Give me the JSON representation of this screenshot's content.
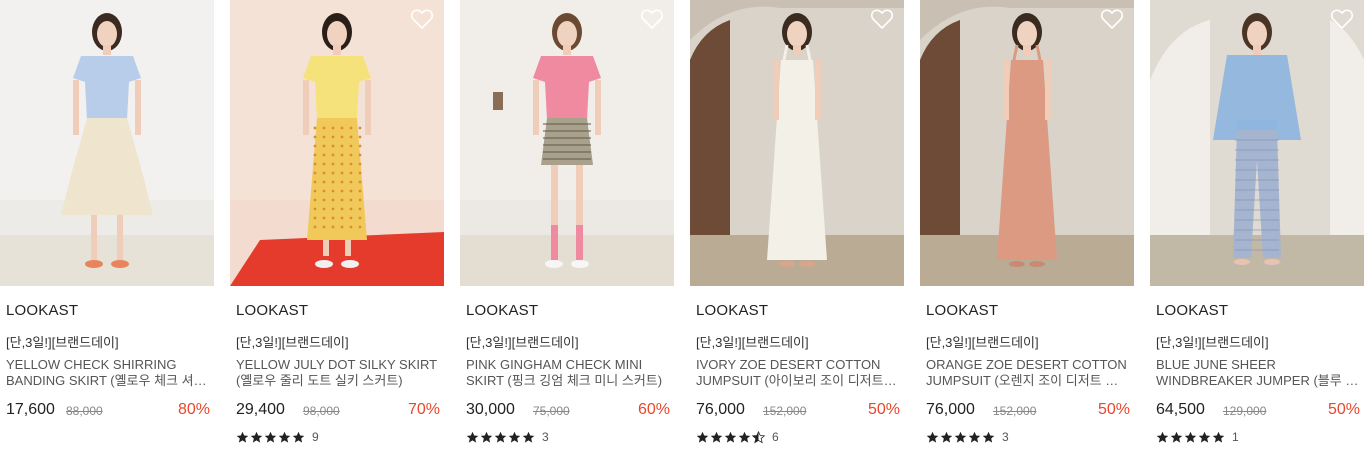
{
  "products": [
    {
      "brand": "LOOKAST",
      "promo": "[단,3일!][브랜드데이]",
      "name": "YELLOW CHECK SHIRRING BANDING SKIRT (옐로우 체크 셔링 밴딩 스커트)",
      "price": "17,600",
      "original_price": "88,000",
      "discount": "80%",
      "rating": 5,
      "review_count": "",
      "image_desc": "model-blue-tee-cream-tiered-skirt"
    },
    {
      "brand": "LOOKAST",
      "promo": "[단,3일!][브랜드데이]",
      "name": "YELLOW JULY DOT SILKY SKIRT (옐로우 줄리 도트 실키 스커트)",
      "price": "29,400",
      "original_price": "98,000",
      "discount": "70%",
      "rating": 5,
      "review_count": "9",
      "image_desc": "model-yellow-tee-yellow-dot-skirt"
    },
    {
      "brand": "LOOKAST",
      "promo": "[단,3일!][브랜드데이]",
      "name": "PINK GINGHAM CHECK MINI SKIRT (핑크 깅엄 체크 미니 스커트)",
      "price": "30,000",
      "original_price": "75,000",
      "discount": "60%",
      "rating": 5,
      "review_count": "3",
      "image_desc": "model-pink-tee-gingham-mini-skirt"
    },
    {
      "brand": "LOOKAST",
      "promo": "[단,3일!][브랜드데이]",
      "name": "IVORY ZOE DESERT COTTON JUMPSUIT (아이보리 조이 디저트 코튼 점프수트)",
      "price": "76,000",
      "original_price": "152,000",
      "discount": "50%",
      "rating": 4.5,
      "review_count": "6",
      "image_desc": "model-ivory-jumpsuit"
    },
    {
      "brand": "LOOKAST",
      "promo": "[단,3일!][브랜드데이]",
      "name": "ORANGE ZOE DESERT COTTON JUMPSUIT (오렌지 조이 디저트 코튼 점프수트)",
      "price": "76,000",
      "original_price": "152,000",
      "discount": "50%",
      "rating": 5,
      "review_count": "3",
      "image_desc": "model-orange-jumpsuit"
    },
    {
      "brand": "LOOKAST",
      "promo": "[단,3일!][브랜드데이]",
      "name": "BLUE JUNE SHEER WINDBREAKER JUMPER (블루 준 시어 윈드브레이커 점퍼)",
      "price": "64,500",
      "original_price": "129,000",
      "discount": "50%",
      "rating": 5,
      "review_count": "1",
      "image_desc": "model-blue-windbreaker-check-pants"
    }
  ],
  "colors": {
    "discount": "#e8472b",
    "star": "#222222",
    "text": "#222222"
  },
  "icons": {
    "wishlist": "heart-outline-icon",
    "rating": "star-icon"
  }
}
